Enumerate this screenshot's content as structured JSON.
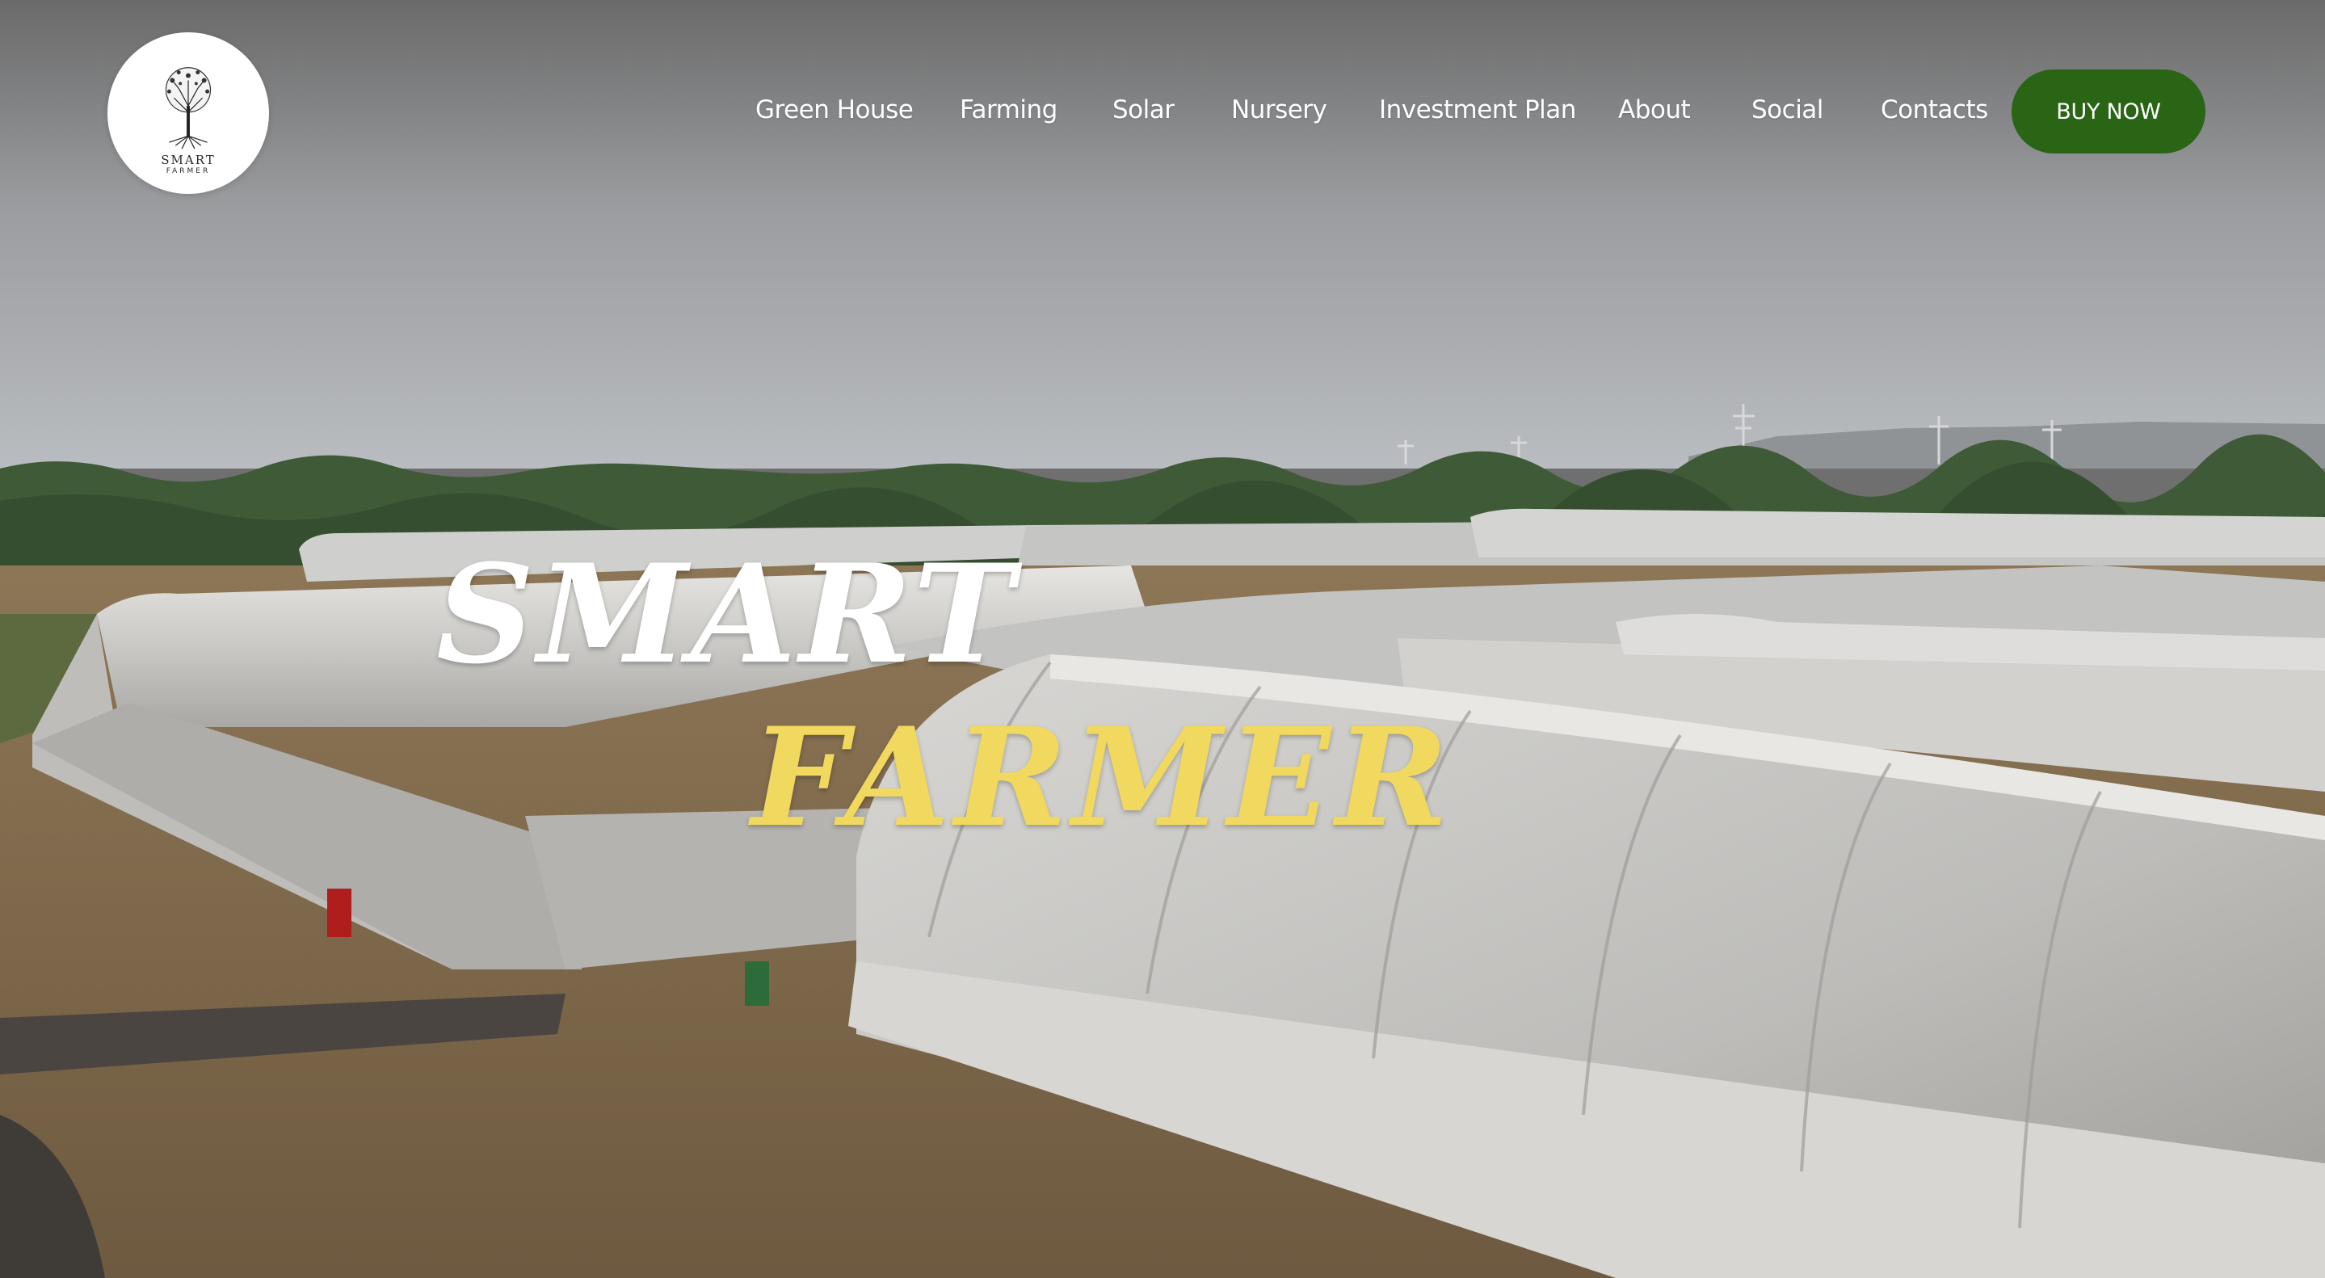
{
  "brand": {
    "logo_icon": "tree-icon",
    "logo_line1": "SMART",
    "logo_line2": "FARMER"
  },
  "nav": {
    "items": [
      {
        "label": "Green House"
      },
      {
        "label": "Farming"
      },
      {
        "label": "Solar"
      },
      {
        "label": "Nursery"
      },
      {
        "label": "Investment Plan"
      },
      {
        "label": "About"
      },
      {
        "label": "Social"
      },
      {
        "label": "Contacts"
      }
    ],
    "cta_label": "BUY NOW"
  },
  "hero": {
    "title_line1": "SMART",
    "title_line2": "FARMER",
    "background": "aerial photo of white polyhouse greenhouse tunnels on farmland"
  },
  "colors": {
    "cta_background": "#2a6415",
    "title_line1": "#ffffff",
    "title_line2": "#f1d85f",
    "nav_text": "#ffffff"
  }
}
